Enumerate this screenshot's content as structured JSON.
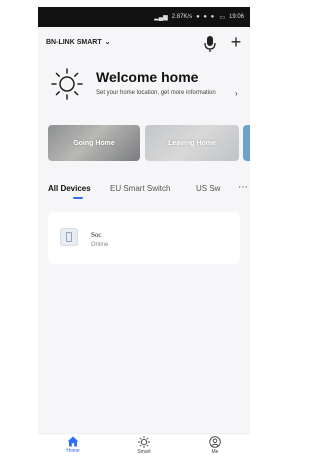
{
  "status_bar": {
    "network": "2.87K/s",
    "time": "19:06"
  },
  "header": {
    "home_name": "BN-LINK SMART"
  },
  "welcome": {
    "title": "Welcome home",
    "subtitle": "Set your home location, get more information"
  },
  "scenes": [
    {
      "label": "Going Home"
    },
    {
      "label": "Leaving Home"
    }
  ],
  "tabs": [
    {
      "label": "All Devices",
      "active": true
    },
    {
      "label": "EU Smart Switch",
      "active": false
    },
    {
      "label": "US Sw",
      "active": false
    }
  ],
  "devices": [
    {
      "name": "Soc",
      "status": "Online"
    }
  ],
  "bottom_nav": [
    {
      "label": "Home",
      "active": true,
      "icon": "home-icon"
    },
    {
      "label": "Smart",
      "active": false,
      "icon": "sun-icon"
    },
    {
      "label": "Me",
      "active": false,
      "icon": "profile-icon"
    }
  ],
  "colors": {
    "accent": "#2f6ef6"
  }
}
